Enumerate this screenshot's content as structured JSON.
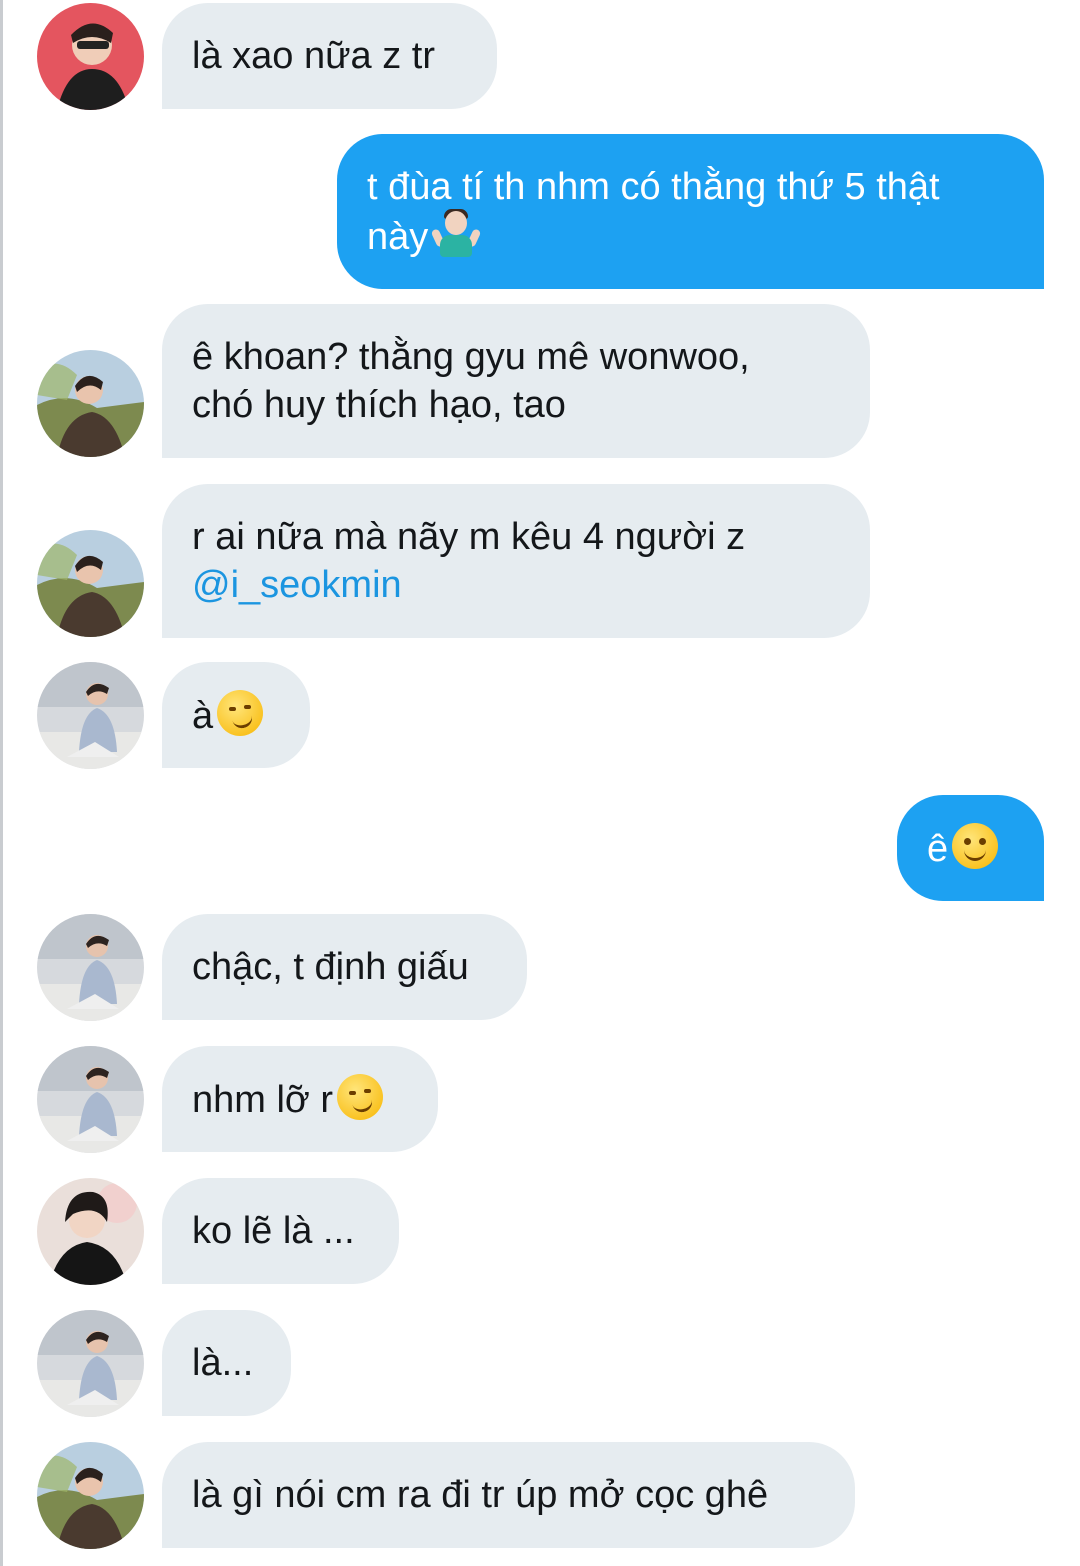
{
  "messages": [
    {
      "text": "là xao nữa z tr",
      "emoji": ""
    },
    {
      "text_line1": "t đùa tí th nhm có thằng thứ 5 thật",
      "text_line2": "này",
      "emoji": "shrug-emoji"
    },
    {
      "text_line1": "ê khoan? thằng gyu mê wonwoo,",
      "text_line2": "chó huy thích hạo, tao"
    },
    {
      "text_line1": "r ai nữa mà nãy m kêu 4 người z",
      "mention": "@i_seokmin"
    },
    {
      "text": "à",
      "emoji": "smirk-emoji"
    },
    {
      "text": "ê",
      "emoji": "smile-emoji"
    },
    {
      "text": "chậc, t định giấu"
    },
    {
      "text": "nhm lỡ r",
      "emoji": "smirk-emoji"
    },
    {
      "text": "ko lẽ là ..."
    },
    {
      "text": "là..."
    },
    {
      "text": "là gì nói cm ra đi tr úp mở cọc ghê"
    }
  ],
  "colors": {
    "incoming_bubble": "#e6ecf0",
    "outgoing_bubble": "#1da1f2",
    "mention": "#1b95e0"
  }
}
